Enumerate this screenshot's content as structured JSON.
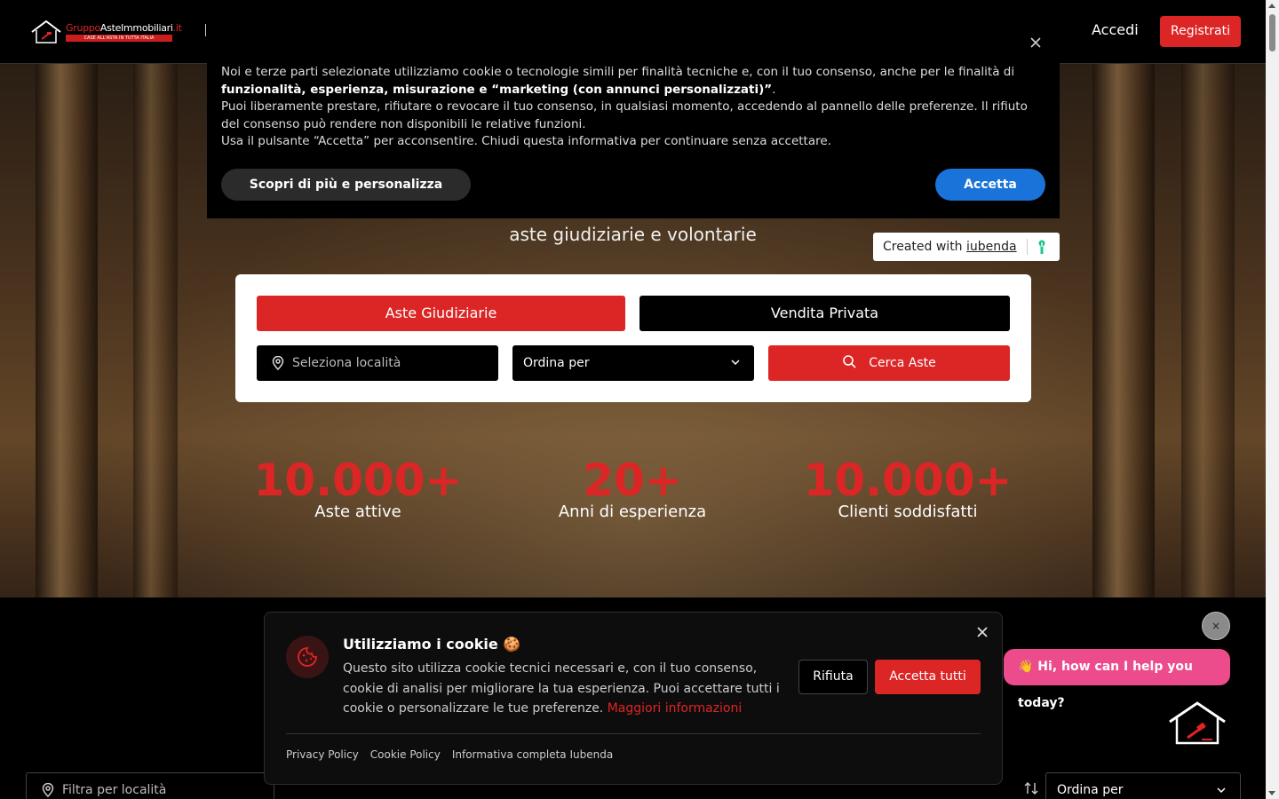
{
  "header": {
    "logo_text_a": "Gruppo",
    "logo_text_b": "Aste",
    "logo_text_c": "Immobiliari",
    "logo_text_d": ".it",
    "logo_tagline": "CASE ALL'ASTA IN TUTTA ITALIA",
    "login_label": "Accedi",
    "register_label": "Registrati"
  },
  "hero": {
    "subtitle": "aste giudiziarie e volontarie",
    "tabs": [
      {
        "label": "Aste Giudiziarie"
      },
      {
        "label": "Vendita Privata"
      }
    ],
    "location_placeholder": "Seleziona località",
    "order_label": "Ordina per",
    "search_label": "Cerca Aste",
    "stats": [
      {
        "value": "10.000+",
        "label": "Aste attive"
      },
      {
        "value": "20+",
        "label": "Anni di esperienza"
      },
      {
        "value": "10.000+",
        "label": "Clienti soddisfatti"
      }
    ]
  },
  "iubenda": {
    "p1_start": "Noi e terze parti selezionate utilizziamo cookie o tecnologie simili per finalità tecniche e, con il tuo consenso, anche per le finalità di ",
    "p1_bold": "funzionalità, esperienza, misurazione e “marketing (con annunci personalizzati)”",
    "p1_end": ".",
    "p2": "Puoi liberamente prestare, rifiutare o revocare il tuo consenso, in qualsiasi momento, accedendo al pannello delle preferenze. Il rifiuto del consenso può rendere non disponibili le relative funzioni.",
    "p3": "Usa il pulsante “Accetta” per acconsentire. Chiudi questa informativa per continuare senza accettare.",
    "customize_label": "Scopri di più e personalizza",
    "accept_label": "Accetta",
    "created_with": "Created with ",
    "brand": "iubenda"
  },
  "cookie_modal": {
    "title": "Utilizziamo i cookie 🍪",
    "description": "Questo sito utilizza cookie tecnici necessari e, con il tuo consenso, cookie di analisi per migliorare la tua esperienza. Puoi accettare tutti i cookie o personalizzare le tue preferenze. ",
    "more_link": "Maggiori informazioni",
    "reject_label": "Rifiuta",
    "accept_all_label": "Accetta tutti",
    "links": [
      "Privacy Policy",
      "Cookie Policy",
      "Informativa completa Iubenda"
    ]
  },
  "listing": {
    "filter_placeholder": "Filtra per località",
    "order_label": "Ordina per"
  },
  "chat": {
    "close_label": "×",
    "bubble_text": "👋 Hi, how can I help you today?"
  },
  "colors": {
    "accent_red": "#dc2626",
    "iubenda_blue": "#1a73d9",
    "chat_pink": "#ec4c8c"
  },
  "icons": [
    "close-icon",
    "location-pin-icon",
    "chevron-down-icon",
    "search-icon",
    "cookie-icon",
    "sort-icon",
    "house-gavel-icon",
    "key-icon"
  ]
}
